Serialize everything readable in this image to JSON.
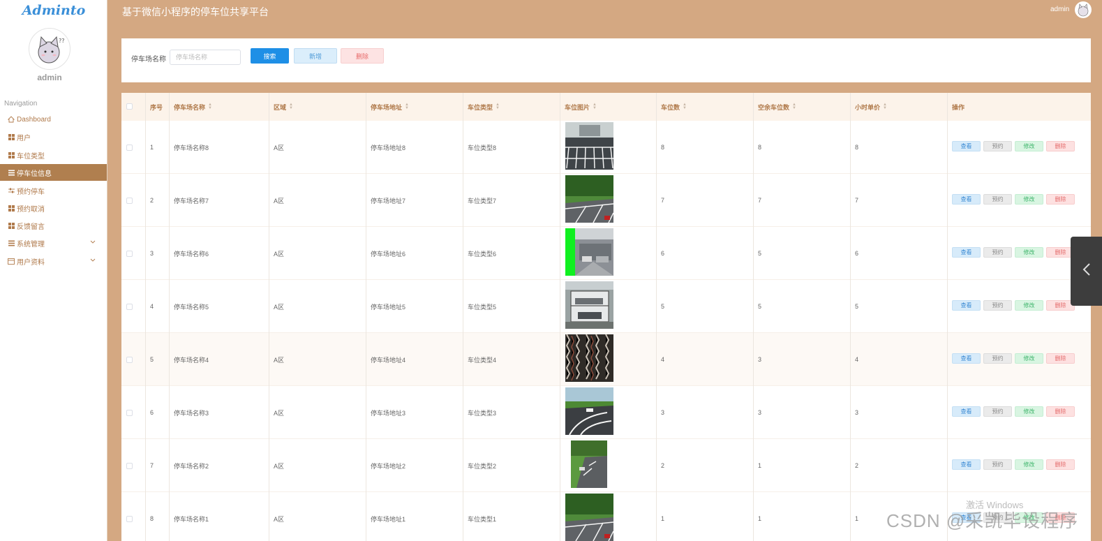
{
  "app": {
    "logo_text": "Adminto",
    "title": "基于微信小程序的停车位共享平台",
    "user": "admin"
  },
  "sidebar": {
    "username": "admin",
    "nav_title": "Navigation",
    "items": [
      {
        "label": "Dashboard",
        "icon": "home-icon"
      },
      {
        "label": "用户",
        "icon": "grid-icon"
      },
      {
        "label": "车位类型",
        "icon": "grid-icon"
      },
      {
        "label": "停车位信息",
        "icon": "list-icon",
        "active": true
      },
      {
        "label": "预约停车",
        "icon": "sliders-icon"
      },
      {
        "label": "预约取消",
        "icon": "grid-icon"
      },
      {
        "label": "反馈留言",
        "icon": "grid-icon"
      },
      {
        "label": "系统管理",
        "icon": "list-icon",
        "has_submenu": true
      },
      {
        "label": "用户资料",
        "icon": "card-icon",
        "has_submenu": true
      }
    ]
  },
  "search": {
    "label": "停车场名称",
    "placeholder": "停车场名称",
    "search_button": "搜索",
    "add_button": "新增",
    "delete_button": "删除"
  },
  "table": {
    "headers": [
      "序号",
      "停车场名称",
      "区域",
      "停车场地址",
      "车位类型",
      "车位图片",
      "车位数",
      "空余车位数",
      "小时单价",
      "操作"
    ],
    "rows": [
      {
        "no": "1",
        "name": "停车场名称8",
        "area": "A区",
        "address": "停车场地址8",
        "type": "车位类型8",
        "image": "parking-lot-lines",
        "total": "8",
        "free": "8",
        "price": "8"
      },
      {
        "no": "2",
        "name": "停车场名称7",
        "area": "A区",
        "address": "停车场地址7",
        "type": "车位类型7",
        "image": "roadside-parking",
        "total": "7",
        "free": "7",
        "price": "7"
      },
      {
        "no": "3",
        "name": "停车场名称6",
        "area": "A区",
        "address": "停车场地址6",
        "type": "车位类型6",
        "image": "underground-garage",
        "total": "6",
        "free": "5",
        "price": "6"
      },
      {
        "no": "4",
        "name": "停车场名称5",
        "area": "A区",
        "address": "停车场地址5",
        "type": "车位类型5",
        "image": "stacked-parking",
        "total": "5",
        "free": "5",
        "price": "5"
      },
      {
        "no": "5",
        "name": "停车场名称4",
        "area": "A区",
        "address": "停车场地址4",
        "type": "车位类型4",
        "image": "dense-car-park",
        "total": "4",
        "free": "3",
        "price": "4"
      },
      {
        "no": "6",
        "name": "停车场名称3",
        "area": "A区",
        "address": "停车场地址3",
        "type": "车位类型3",
        "image": "curved-parking",
        "total": "3",
        "free": "3",
        "price": "3"
      },
      {
        "no": "7",
        "name": "停车场名称2",
        "area": "A区",
        "address": "停车场地址2",
        "type": "车位类型2",
        "image": "street-parking",
        "total": "2",
        "free": "1",
        "price": "2"
      },
      {
        "no": "8",
        "name": "停车场名称1",
        "area": "A区",
        "address": "停车场地址1",
        "type": "车位类型1",
        "image": "roadside-parking",
        "total": "1",
        "free": "1",
        "price": "1"
      }
    ],
    "actions": {
      "view": "查看",
      "book": "预约",
      "edit": "修改",
      "delete": "删除"
    }
  },
  "watermark": {
    "activate": "激活 Windows",
    "csdn": "CSDN @采凯毕设程序"
  }
}
